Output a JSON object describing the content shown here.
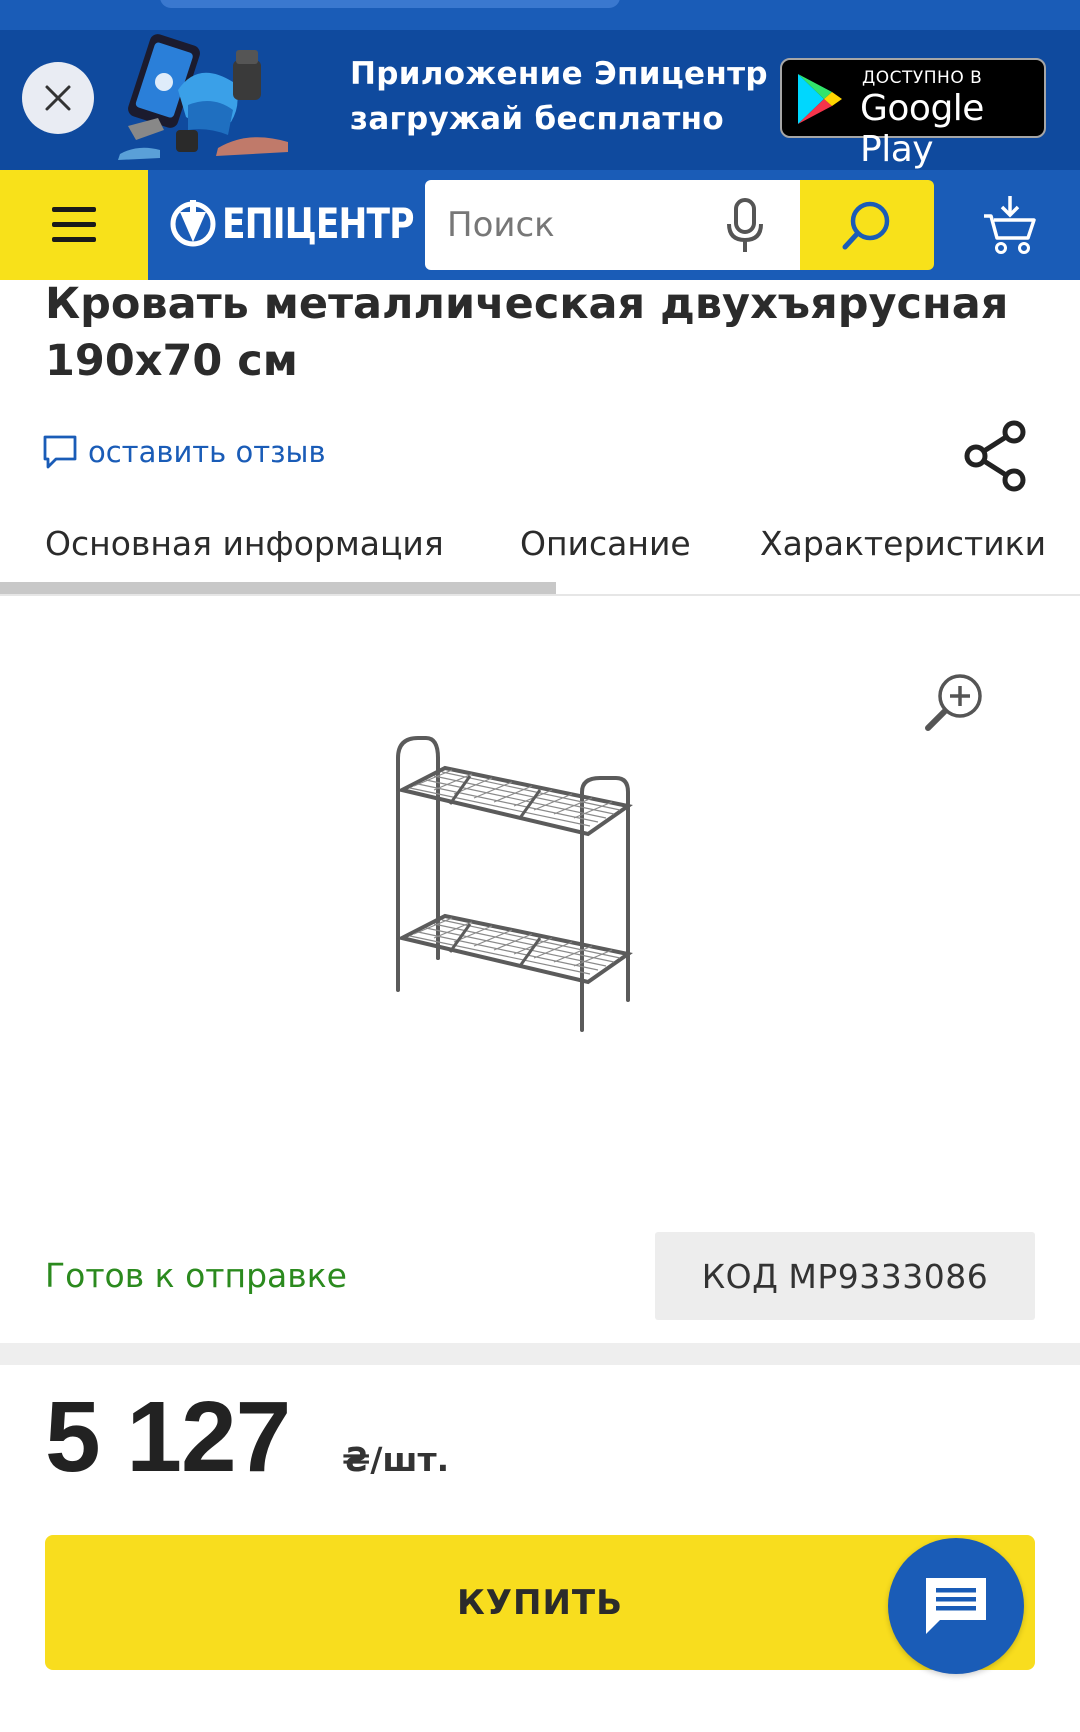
{
  "app_banner": {
    "line1": "Приложение Эпицентр",
    "line2": "загружай бесплатно",
    "store_small": "ДОСТУПНО В",
    "store_big": "Google Play"
  },
  "header": {
    "logo_text": "ЕПІЦЕНТР",
    "search_placeholder": "Поиск"
  },
  "product": {
    "title": "Кровать металлическая двухъярусная 190x70 см",
    "review_link": "оставить отзыв",
    "status": "Готов к отправке",
    "code_label": "КОД",
    "code_value": "MP9333086",
    "price": "5 127",
    "price_unit": "₴/шт.",
    "buy_label": "КУПИТЬ"
  },
  "tabs": [
    {
      "label": "Основная информация",
      "active": true
    },
    {
      "label": "Описание",
      "active": false
    },
    {
      "label": "Характеристики",
      "active": false
    }
  ],
  "colors": {
    "brand_blue": "#1a5cb7",
    "banner_blue": "#0f4a9e",
    "brand_yellow": "#f8e11a",
    "status_green": "#2b8a1e"
  }
}
